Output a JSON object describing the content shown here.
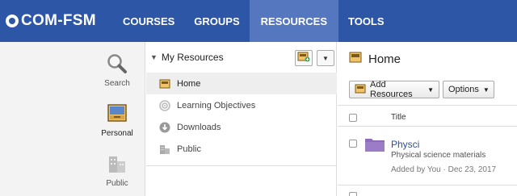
{
  "brand": {
    "name": "COM-FSM"
  },
  "nav": {
    "items": [
      {
        "label": "COURSES"
      },
      {
        "label": "GROUPS"
      },
      {
        "label": "RESOURCES",
        "active": true
      },
      {
        "label": "TOOLS"
      }
    ]
  },
  "leftnav": {
    "items": [
      {
        "label": "Search",
        "icon": "magnifier-icon"
      },
      {
        "label": "Personal",
        "icon": "personal-box-icon",
        "active": true
      },
      {
        "label": "Public",
        "icon": "buildings-icon"
      }
    ]
  },
  "my_resources": {
    "title": "My Resources",
    "items": [
      {
        "label": "Home",
        "icon": "box-icon",
        "active": true
      },
      {
        "label": "Learning Objectives",
        "icon": "target-icon"
      },
      {
        "label": "Downloads",
        "icon": "download-icon"
      },
      {
        "label": "Public",
        "icon": "buildings-icon"
      }
    ]
  },
  "content": {
    "title": "Home",
    "add_resources_label": "Add Resources",
    "options_label": "Options",
    "column_title": "Title",
    "rows": [
      {
        "name": "Physci",
        "description": "Physical science materials",
        "meta": "Added by You · Dec 23, 2017"
      }
    ]
  },
  "colors": {
    "nav_bg": "#2e56a6",
    "nav_active": "#5577bf",
    "link": "#2b4f9e",
    "folder": "#8e6bb8"
  }
}
